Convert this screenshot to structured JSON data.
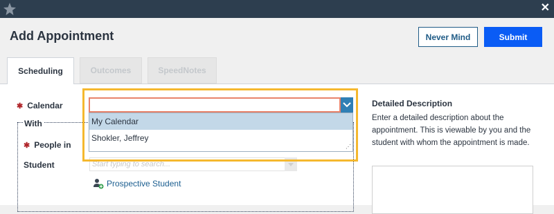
{
  "window": {
    "logo_icon": "star-logo-icon",
    "close_label": "✕"
  },
  "header": {
    "title": "Add Appointment",
    "never_mind_label": "Never Mind",
    "submit_label": "Submit",
    "submit_color": "#0a5cf5"
  },
  "tabs": [
    {
      "label": "Scheduling",
      "active": true
    },
    {
      "label": "Outcomes",
      "active": false
    },
    {
      "label": "SpeedNotes",
      "active": false
    }
  ],
  "form": {
    "required_mark": "✱",
    "calendar_label": "Calendar",
    "calendar_value": "",
    "calendar_options": [
      "My Calendar",
      "Shokler, Jeffrey"
    ],
    "with_legend": "With",
    "people_in_label": "People in",
    "student_label": "Student",
    "student_placeholder": "Start typing to search...",
    "prospective_label": "Prospective Student"
  },
  "description": {
    "title": "Detailed Description",
    "text": "Enter a detailed description about the appointment. This is viewable by you and the student with whom the appointment is made."
  },
  "colors": {
    "highlight": "#f5b82e",
    "titlebar": "#2d3e4f",
    "accent": "#2f7fb5"
  }
}
